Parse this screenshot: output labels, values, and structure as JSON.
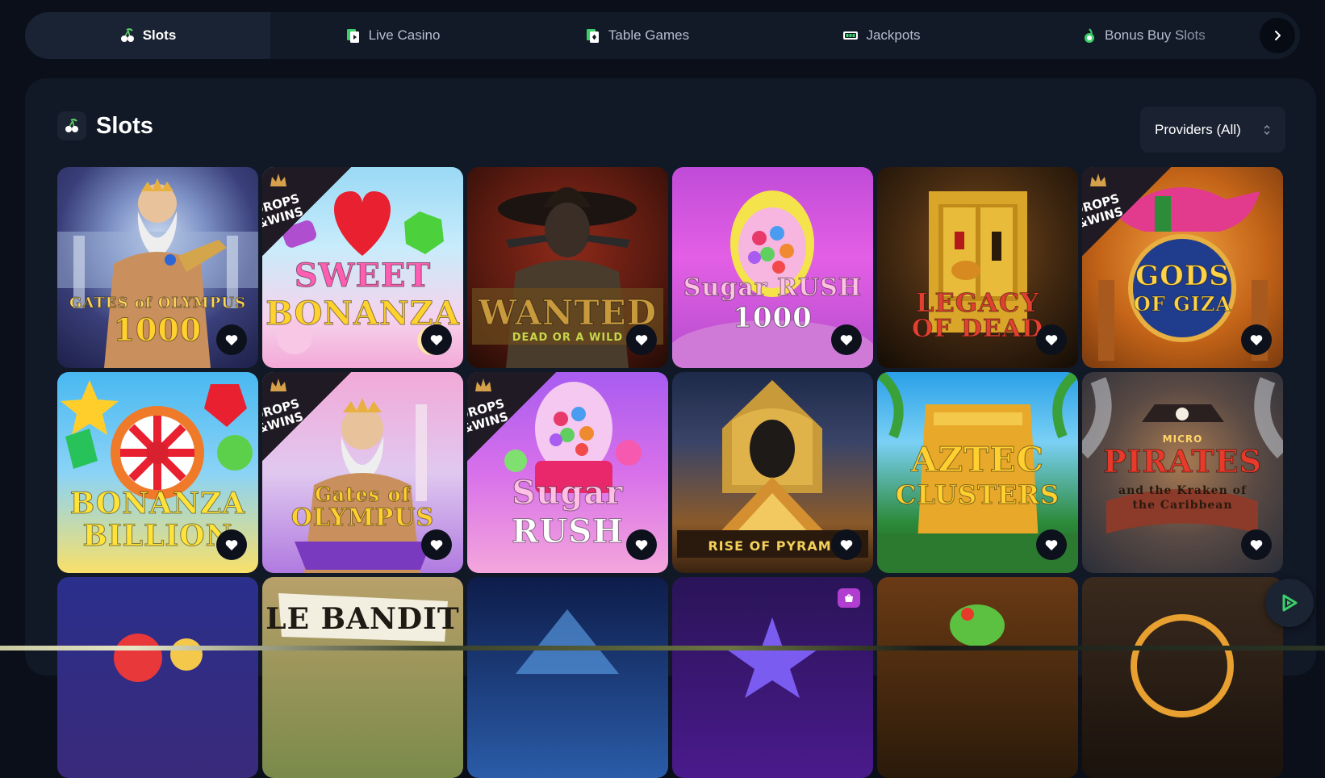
{
  "tabs": [
    {
      "label": "Slots",
      "icon": "cherry-icon",
      "active": true
    },
    {
      "label": "Live Casino",
      "icon": "live-card-icon",
      "active": false
    },
    {
      "label": "Table Games",
      "icon": "table-card-icon",
      "active": false
    },
    {
      "label": "Jackpots",
      "icon": "jackpot-icon",
      "active": false
    },
    {
      "label": "Bonus Buy Slots",
      "icon": "bonus-buy-icon",
      "active": false
    }
  ],
  "section": {
    "title": "Slots",
    "icon": "cherry-icon",
    "providers_label": "Providers (All)"
  },
  "games": [
    {
      "title": "GATES of OLYMPUS",
      "subtitle": "1000",
      "drops_wins": false
    },
    {
      "title": "SWEET",
      "subtitle": "BONANZA",
      "drops_wins": true
    },
    {
      "title": "WANTED",
      "subtitle": "DEAD OR A WILD",
      "drops_wins": false
    },
    {
      "title": "Sugar RUSH",
      "subtitle": "1000",
      "drops_wins": false
    },
    {
      "title": "LEGACY",
      "subtitle": "OF DEAD",
      "drops_wins": false
    },
    {
      "title": "GODS",
      "subtitle": "OF GIZA",
      "drops_wins": true
    },
    {
      "title": "BONANZA",
      "subtitle": "BILLION",
      "drops_wins": false
    },
    {
      "title": "Gates of",
      "subtitle": "OLYMPUS",
      "drops_wins": true
    },
    {
      "title": "Sugar",
      "subtitle": "RUSH",
      "drops_wins": true
    },
    {
      "title": "",
      "subtitle": "RISE OF PYRAMI",
      "drops_wins": false
    },
    {
      "title": "AZTEC",
      "subtitle": "CLUSTERS",
      "drops_wins": false
    },
    {
      "title": "PIRATES",
      "subtitle": "and the Kraken of the Caribbean",
      "drops_wins": false
    },
    {
      "title": "",
      "subtitle": "",
      "drops_wins": false
    },
    {
      "title": "LE BANDIT",
      "subtitle": "",
      "drops_wins": false
    },
    {
      "title": "",
      "subtitle": "",
      "drops_wins": false
    },
    {
      "title": "",
      "subtitle": "",
      "drops_wins": false
    },
    {
      "title": "",
      "subtitle": "",
      "drops_wins": false
    },
    {
      "title": "",
      "subtitle": "",
      "drops_wins": false
    }
  ],
  "drops_wins_label_1": "DROPS",
  "drops_wins_label_2": "&WINS",
  "micro_label": "MICRO",
  "colors": {
    "background": "#0a0f1a",
    "panel": "#111826",
    "tabbar": "#121a28",
    "accent_green": "#3cd06a"
  }
}
